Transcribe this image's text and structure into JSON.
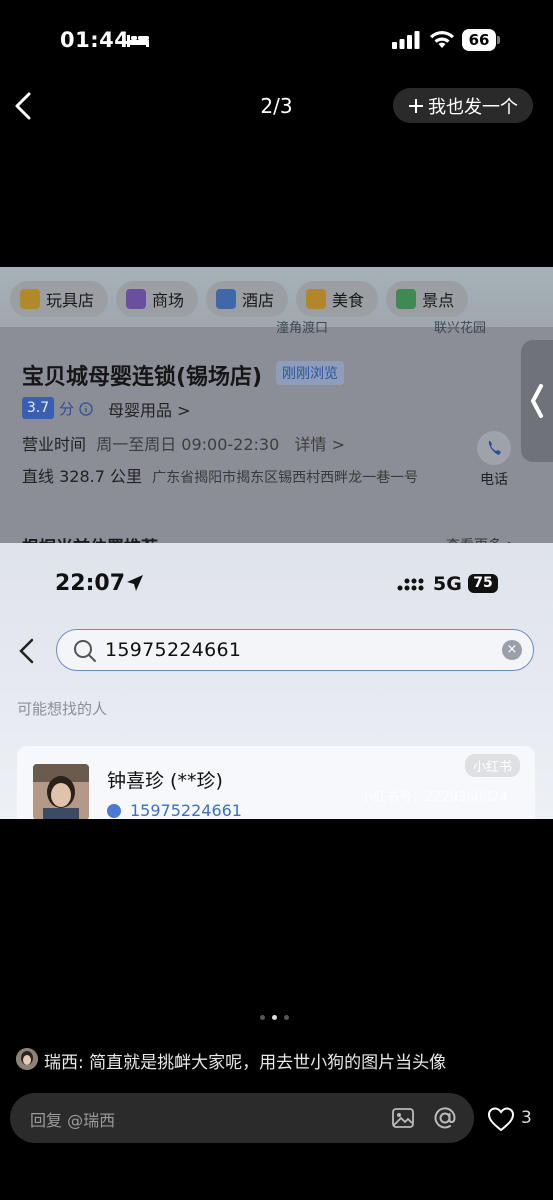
{
  "status_bar": {
    "time": "01:44",
    "battery": "66"
  },
  "nav": {
    "counter": "2/3",
    "post_button": "我也发一个"
  },
  "screenshot_map": {
    "chips": [
      "玩具店",
      "商场",
      "酒店",
      "美食",
      "景点"
    ],
    "map_labels": [
      "潼角渡口",
      "联兴花园"
    ],
    "store_name": "宝贝城母婴连锁(锡场店)",
    "store_tag": "刚刚浏览",
    "rating": "3.7",
    "rating_unit": "分",
    "category": "母婴用品 >",
    "hours_label": "营业时间",
    "hours_value": "周一至周日 09:00-22:30",
    "hours_detail": "详情 >",
    "distance": "直线 328.7 公里",
    "address": "广东省揭阳市揭东区锡西村西畔龙一巷一号",
    "call_label": "电话",
    "recommend_title": "根据当前位置推荐",
    "recommend_more": "查看更多 >"
  },
  "screenshot_phone": {
    "time": "22:07",
    "network": "5G",
    "battery": "75",
    "search_value": "15975224661",
    "hint": "可能想找的人",
    "result_name": "钟喜珍 (**珍)",
    "result_phone": "15975224661",
    "watermark_logo": "小红书",
    "watermark_id": "小红书号：2229360824"
  },
  "pager": {
    "count": 3,
    "active": 2
  },
  "comment": {
    "author": "瑞西",
    "text": "瑞西: 简直就是挑衅大家呢，用去世小狗的图片当头像"
  },
  "reply_bar": {
    "placeholder": "回复 @瑞西",
    "like_count": "3"
  }
}
